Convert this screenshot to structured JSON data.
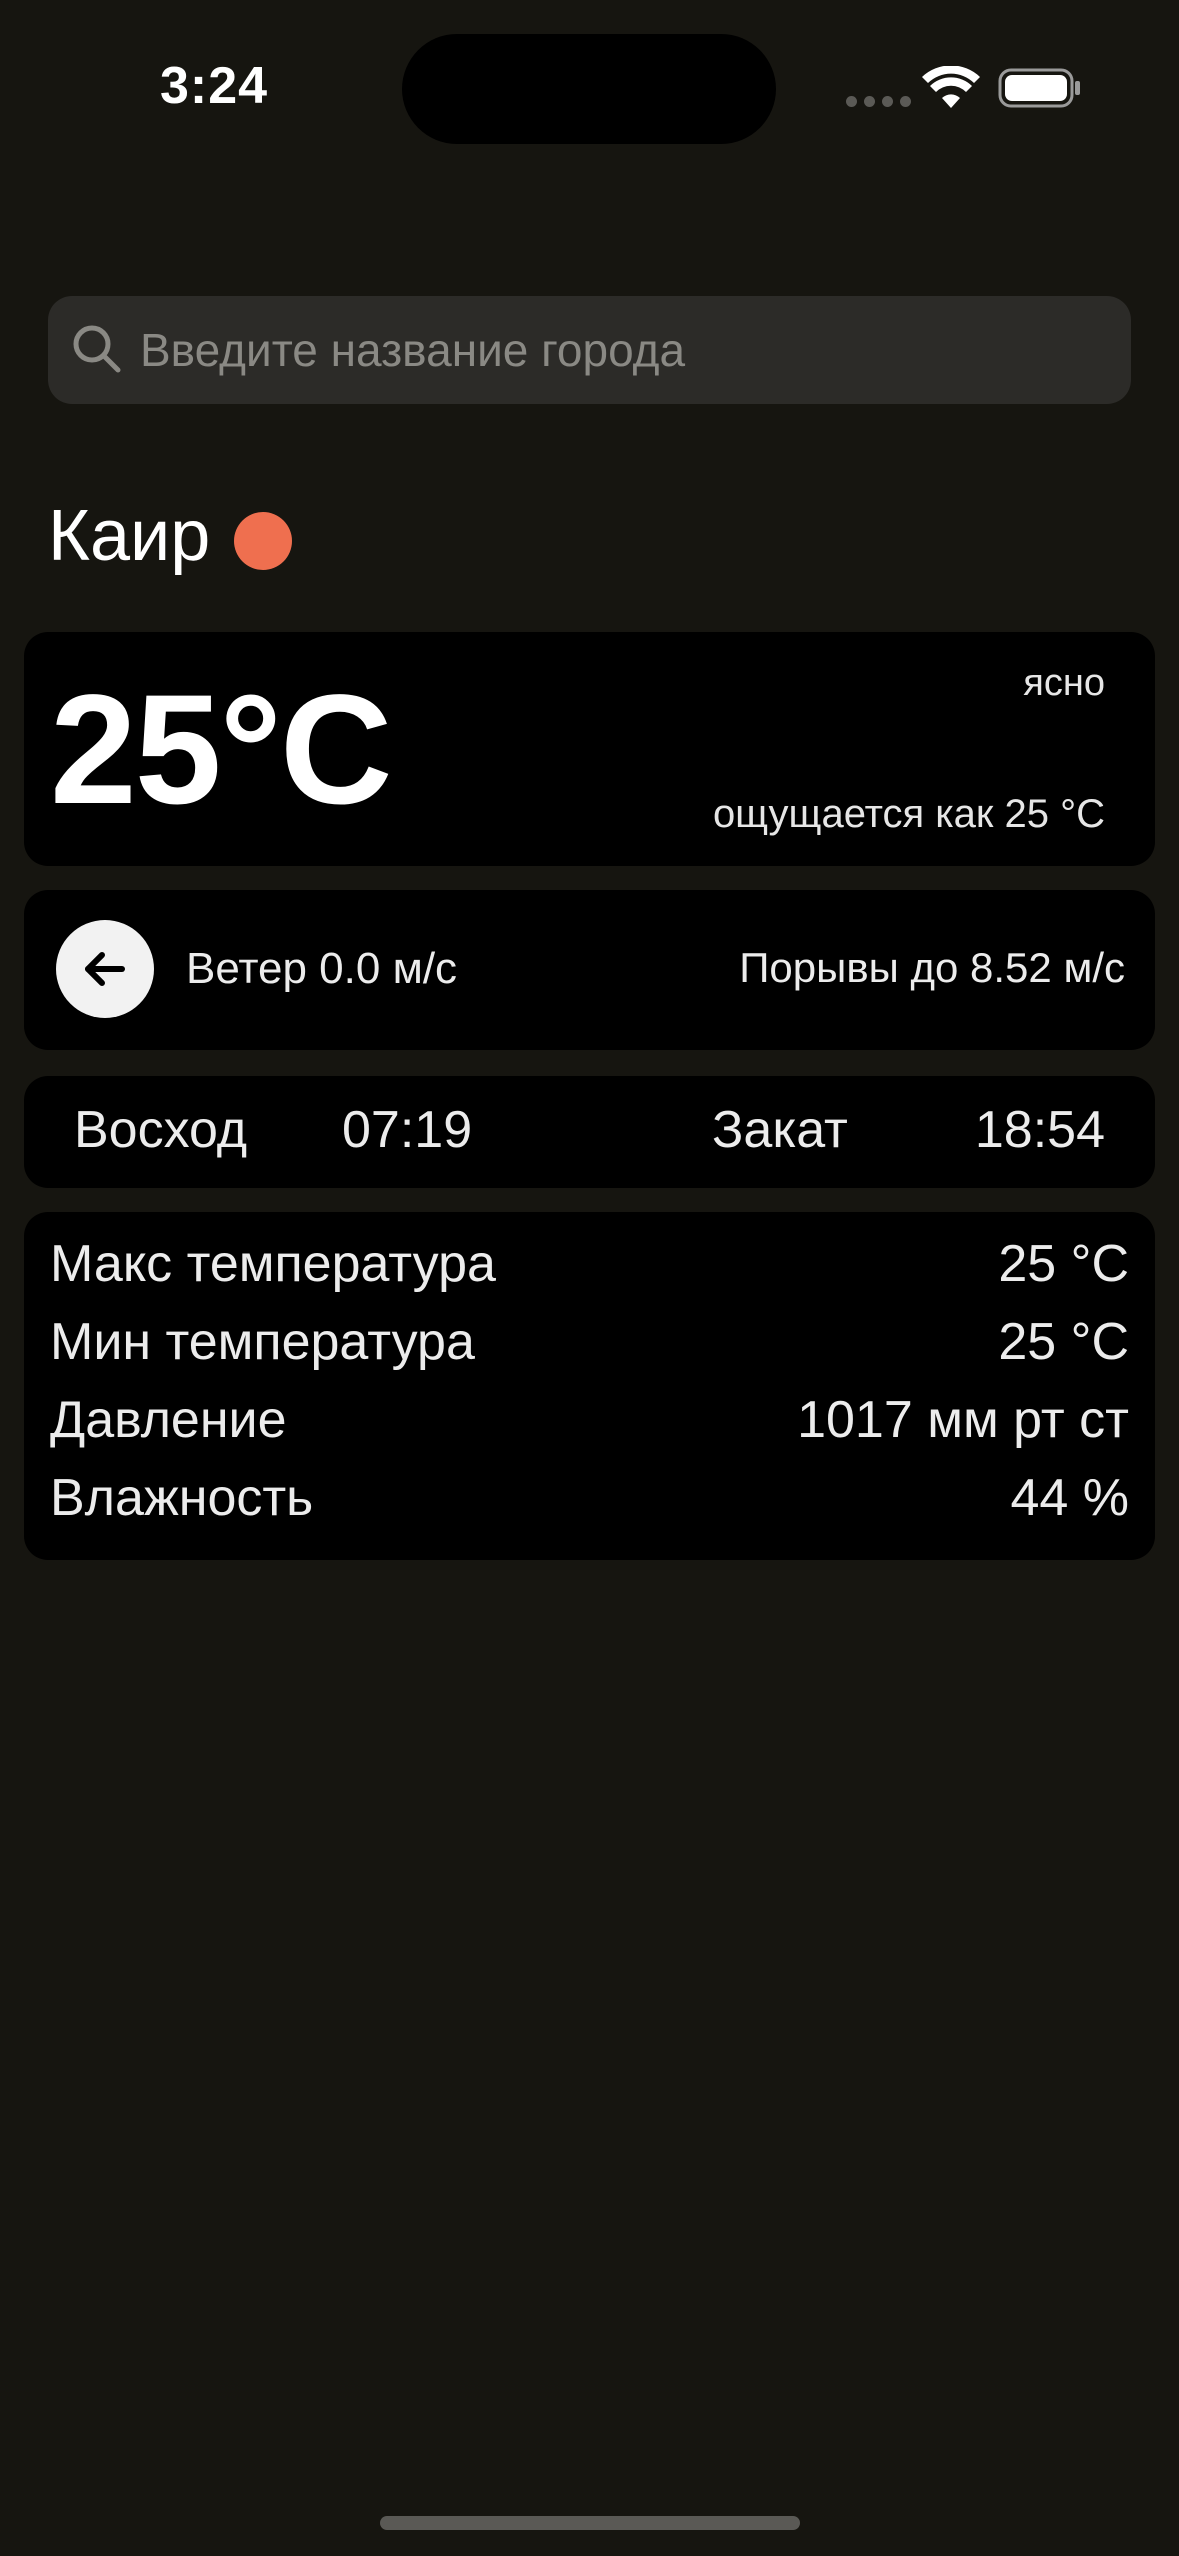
{
  "status_bar": {
    "time": "3:24",
    "icons": [
      "signal-icon",
      "wifi-icon",
      "battery-icon"
    ]
  },
  "search": {
    "placeholder": "Введите название города",
    "value": "",
    "icon": "search-icon"
  },
  "city": {
    "name": "Каир",
    "indicator_color": "#ef6f4f"
  },
  "weather": {
    "temperature": "25°C",
    "description": "ясно",
    "feels_like": "ощущается как 25 °C"
  },
  "wind": {
    "direction_icon": "arrow-left-icon",
    "speed": "Ветер 0.0 м/с",
    "gusts": "Порывы до 8.52 м/с"
  },
  "sun": {
    "sunrise_label": "Восход",
    "sunrise_time": "07:19",
    "sunset_label": "Закат",
    "sunset_time": "18:54"
  },
  "details": [
    {
      "label": "Макс температура",
      "value": "25 °C"
    },
    {
      "label": "Мин температура",
      "value": "25 °C"
    },
    {
      "label": "Давление",
      "value": "1017 мм рт ст"
    },
    {
      "label": "Влажность",
      "value": "44 %"
    }
  ],
  "colors": {
    "background": "#161510",
    "card": "#000000",
    "search_bg": "#2c2b28",
    "accent": "#ef6f4f"
  }
}
